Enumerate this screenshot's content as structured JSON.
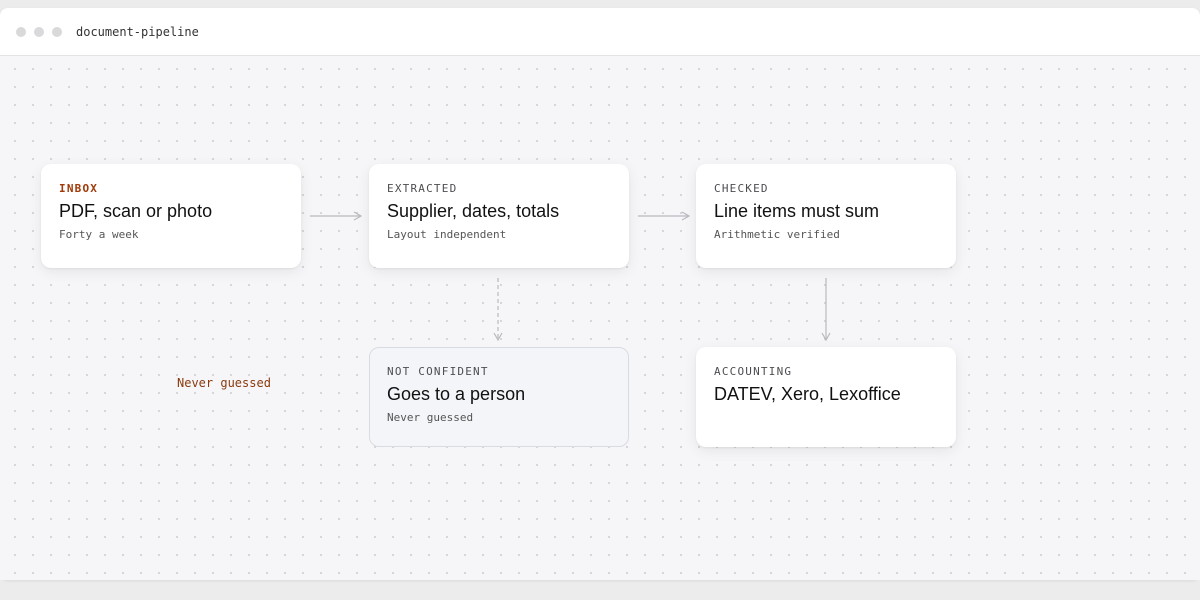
{
  "window": {
    "title": "document-pipeline"
  },
  "colors": {
    "accent": "#a13a0a",
    "edge": "#b9b9bf",
    "dot": "#d9d9dc"
  },
  "nodes": {
    "inbox": {
      "kicker": "INBOX",
      "heading": "PDF, scan or photo",
      "sub": "Forty a week"
    },
    "extracted": {
      "kicker": "EXTRACTED",
      "heading": "Supplier, dates, totals",
      "sub": "Layout independent"
    },
    "checked": {
      "kicker": "CHECKED",
      "heading": "Line items must sum",
      "sub": "Arithmetic verified"
    },
    "not_confident": {
      "kicker": "NOT CONFIDENT",
      "heading": "Goes to a person",
      "sub": "Never guessed"
    },
    "accounting": {
      "kicker": "ACCOUNTING",
      "heading": "DATEV, Xero, Lexoffice"
    }
  },
  "side_note": "Never guessed",
  "edges": [
    {
      "from": "inbox",
      "to": "extracted",
      "style": "solid"
    },
    {
      "from": "extracted",
      "to": "checked",
      "style": "solid"
    },
    {
      "from": "extracted",
      "to": "not_confident",
      "style": "dashed"
    },
    {
      "from": "checked",
      "to": "accounting",
      "style": "solid"
    }
  ]
}
